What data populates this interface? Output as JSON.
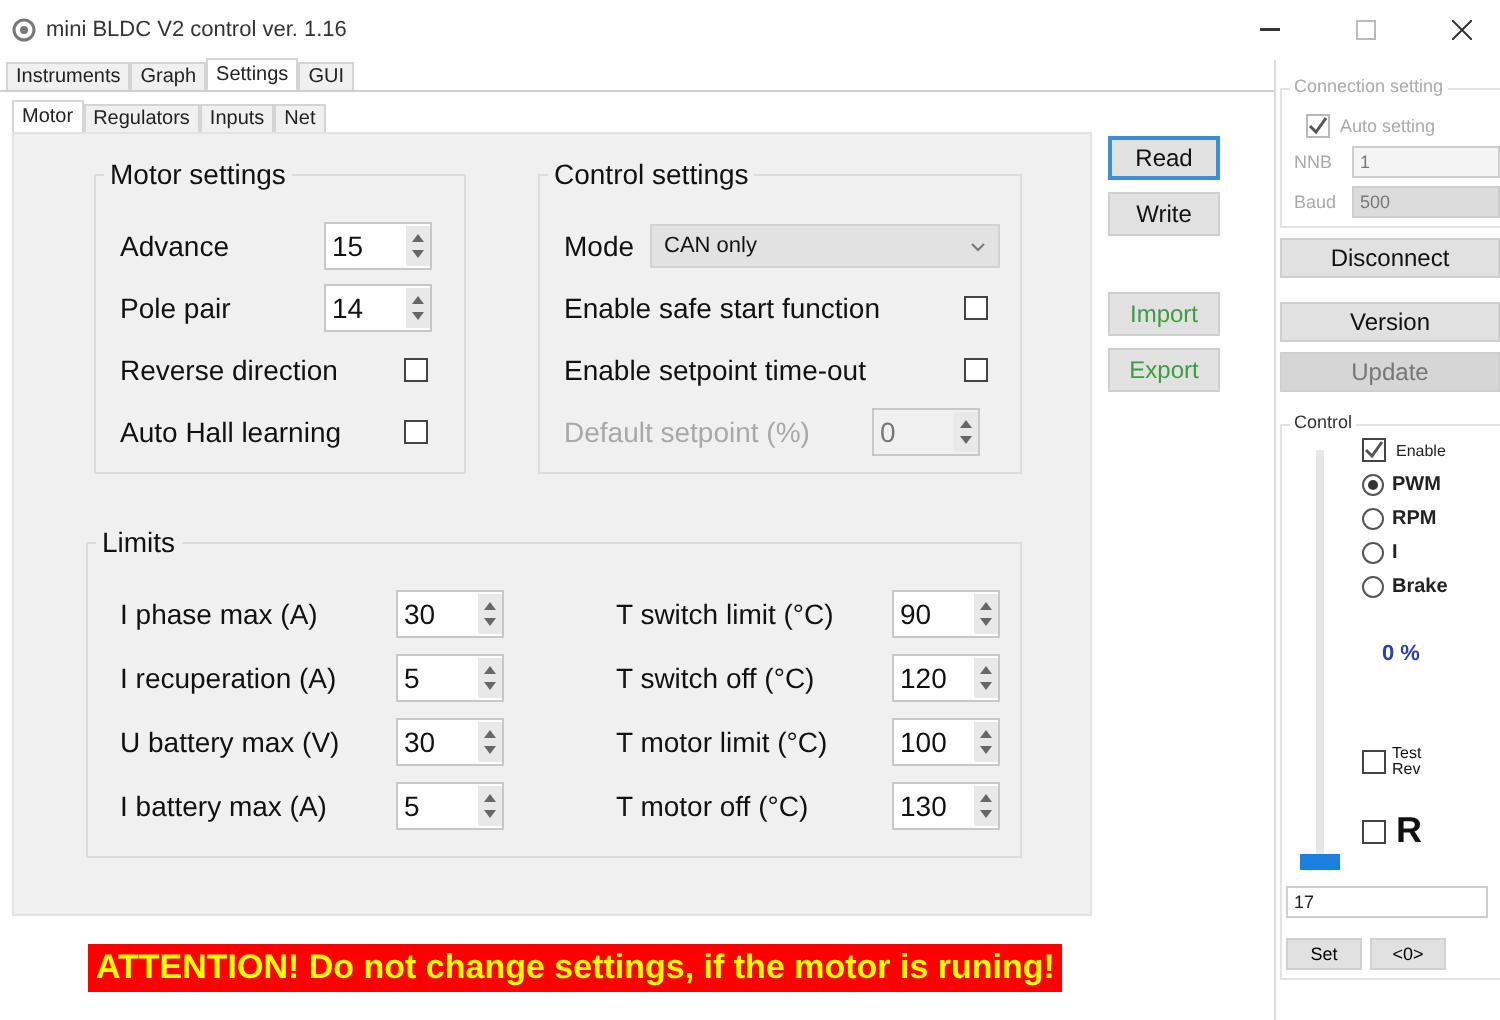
{
  "window": {
    "title": "mini BLDC V2 control ver. 1.16"
  },
  "tabs": [
    {
      "label": "Instruments",
      "selected": false
    },
    {
      "label": "Graph",
      "selected": false
    },
    {
      "label": "Settings",
      "selected": true
    },
    {
      "label": "GUI",
      "selected": false
    }
  ],
  "subtabs": [
    {
      "label": "Motor",
      "selected": true
    },
    {
      "label": "Regulators",
      "selected": false
    },
    {
      "label": "Inputs",
      "selected": false
    },
    {
      "label": "Net",
      "selected": false
    }
  ],
  "motor_settings": {
    "title": "Motor settings",
    "spinners": [
      {
        "label": "Advance",
        "value": "15"
      },
      {
        "label": "Pole pair",
        "value": "14"
      }
    ],
    "checkboxes": [
      {
        "label": "Reverse direction",
        "checked": false
      },
      {
        "label": "Auto Hall learning",
        "checked": false
      }
    ]
  },
  "control_settings": {
    "title": "Control settings",
    "mode": {
      "label": "Mode",
      "value": "CAN only"
    },
    "checkboxes": [
      {
        "label": "Enable safe start function",
        "checked": false
      },
      {
        "label": "Enable setpoint time-out",
        "checked": false
      }
    ],
    "default_setpoint": {
      "label": "Default setpoint (%)",
      "value": "0",
      "disabled": true
    }
  },
  "limits": {
    "title": "Limits",
    "left": [
      {
        "label": "I phase max (A)",
        "value": "30"
      },
      {
        "label": "I recuperation (A)",
        "value": "5"
      },
      {
        "label": "U battery max (V)",
        "value": "30"
      },
      {
        "label": "I battery max (A)",
        "value": "5"
      }
    ],
    "right": [
      {
        "label": "T switch limit (°C)",
        "value": "90"
      },
      {
        "label": "T switch off (°C)",
        "value": "120"
      },
      {
        "label": "T motor limit (°C)",
        "value": "100"
      },
      {
        "label": "T motor off (°C)",
        "value": "130"
      }
    ]
  },
  "buttons": [
    {
      "label": "Read",
      "kind": "focused"
    },
    {
      "label": "Write",
      "kind": "normal"
    },
    {
      "label": "Import",
      "kind": "file"
    },
    {
      "label": "Export",
      "kind": "file"
    }
  ],
  "warning": "ATTENTION! Do not change settings, if the motor is runing!",
  "connection": {
    "title": "Connection setting",
    "disabled": true,
    "auto_setting": {
      "label": "Auto setting",
      "checked": true
    },
    "nnb": {
      "label": "NNB",
      "value": "1"
    },
    "baud": {
      "label": "Baud",
      "value": "500"
    }
  },
  "side_buttons": [
    {
      "label": "Disconnect",
      "disabled": false
    },
    {
      "label": "Version",
      "disabled": false
    },
    {
      "label": "Update",
      "disabled": true
    }
  ],
  "control": {
    "title": "Control",
    "enable": {
      "label": "Enable",
      "checked": true
    },
    "slider": {
      "level": 0
    },
    "modes": [
      {
        "label": "PWM",
        "selected": true
      },
      {
        "label": "RPM",
        "selected": false
      },
      {
        "label": "I",
        "selected": false
      },
      {
        "label": "Brake",
        "selected": false
      }
    ],
    "reading": "0 %",
    "test_rev": {
      "label": "Test Rev",
      "checked": false
    },
    "r": {
      "label": "R",
      "checked": false
    },
    "setpoint": "17",
    "set_button": "Set",
    "step_button": "<0>"
  }
}
